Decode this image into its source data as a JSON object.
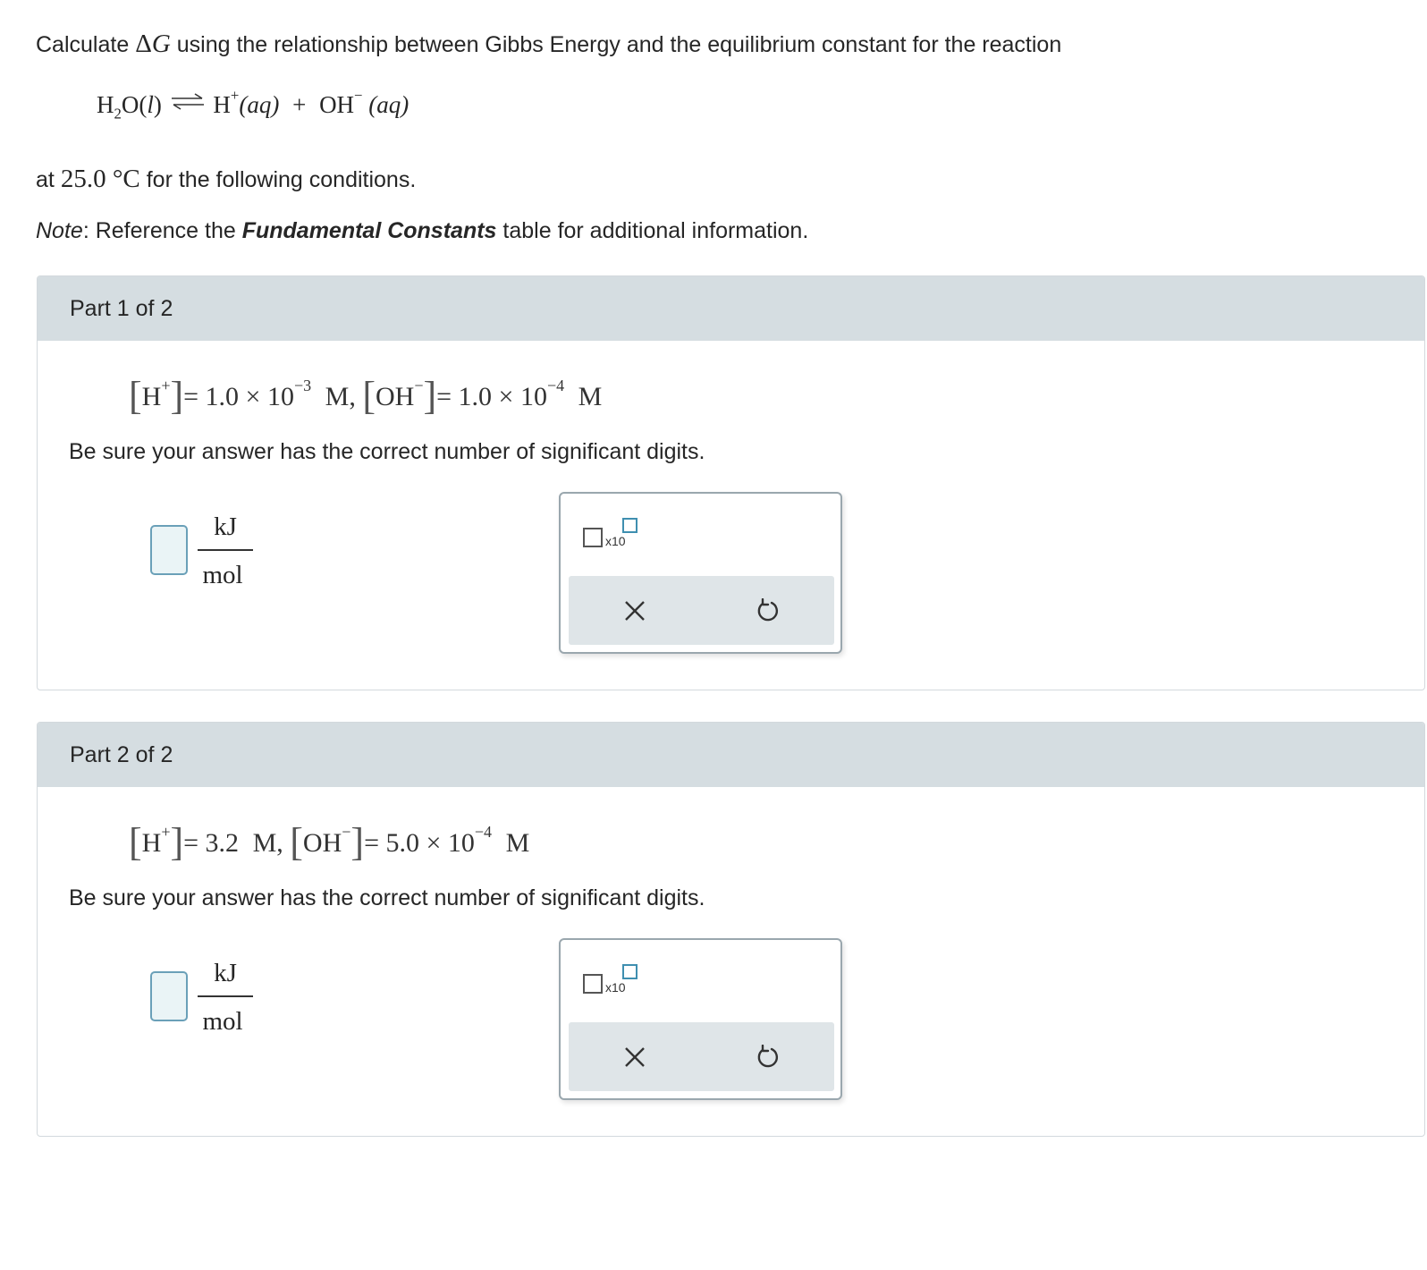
{
  "intro": {
    "calculate": "Calculate",
    "delta_g": "ΔG",
    "rest": "using the relationship between Gibbs Energy and the equilibrium constant for the reaction",
    "reaction": {
      "reactant": "H",
      "reactant_sub": "2",
      "reactant_rest": "O(",
      "phase_l": "l",
      "close": ")",
      "cation": "H",
      "cation_charge": "+",
      "aq1": "(aq)",
      "plus": "+",
      "anion": "OH",
      "anion_charge": "−",
      "aq2": "(aq)"
    },
    "at": "at",
    "temperature": "25.0 °C",
    "conditions_text": "for the following conditions.",
    "note_label": "Note",
    "note_colon": ": Reference the",
    "note_link": "Fundamental Constants",
    "note_rest": "table for additional information."
  },
  "parts": [
    {
      "title": "Part 1 of 2",
      "condition": {
        "h_value": "= 1.0 × 10",
        "h_exp": "−3",
        "h_unit": "M,",
        "oh_value": "= 1.0 × 10",
        "oh_exp": "−4",
        "oh_unit": "M"
      },
      "instruction": "Be sure your answer has the correct number of significant digits.",
      "answer_value": "",
      "unit_num": "kJ",
      "unit_den": "mol",
      "sci_label": "x10"
    },
    {
      "title": "Part 2 of 2",
      "condition": {
        "h_value": "= 3.2",
        "h_exp": "",
        "h_unit": "M,",
        "oh_value": "= 5.0 × 10",
        "oh_exp": "−4",
        "oh_unit": "M"
      },
      "instruction": "Be sure your answer has the correct number of significant digits.",
      "answer_value": "",
      "unit_num": "kJ",
      "unit_den": "mol",
      "sci_label": "x10"
    }
  ],
  "icons": {
    "clear": "close-icon",
    "undo": "undo-icon"
  },
  "colors": {
    "part_header": "#d5dde1",
    "toolbar": "#dfe5e8",
    "answer_border": "#6aa0b8",
    "answer_fill": "#eaf4f6",
    "exponent_box": "#3f8fb0"
  }
}
